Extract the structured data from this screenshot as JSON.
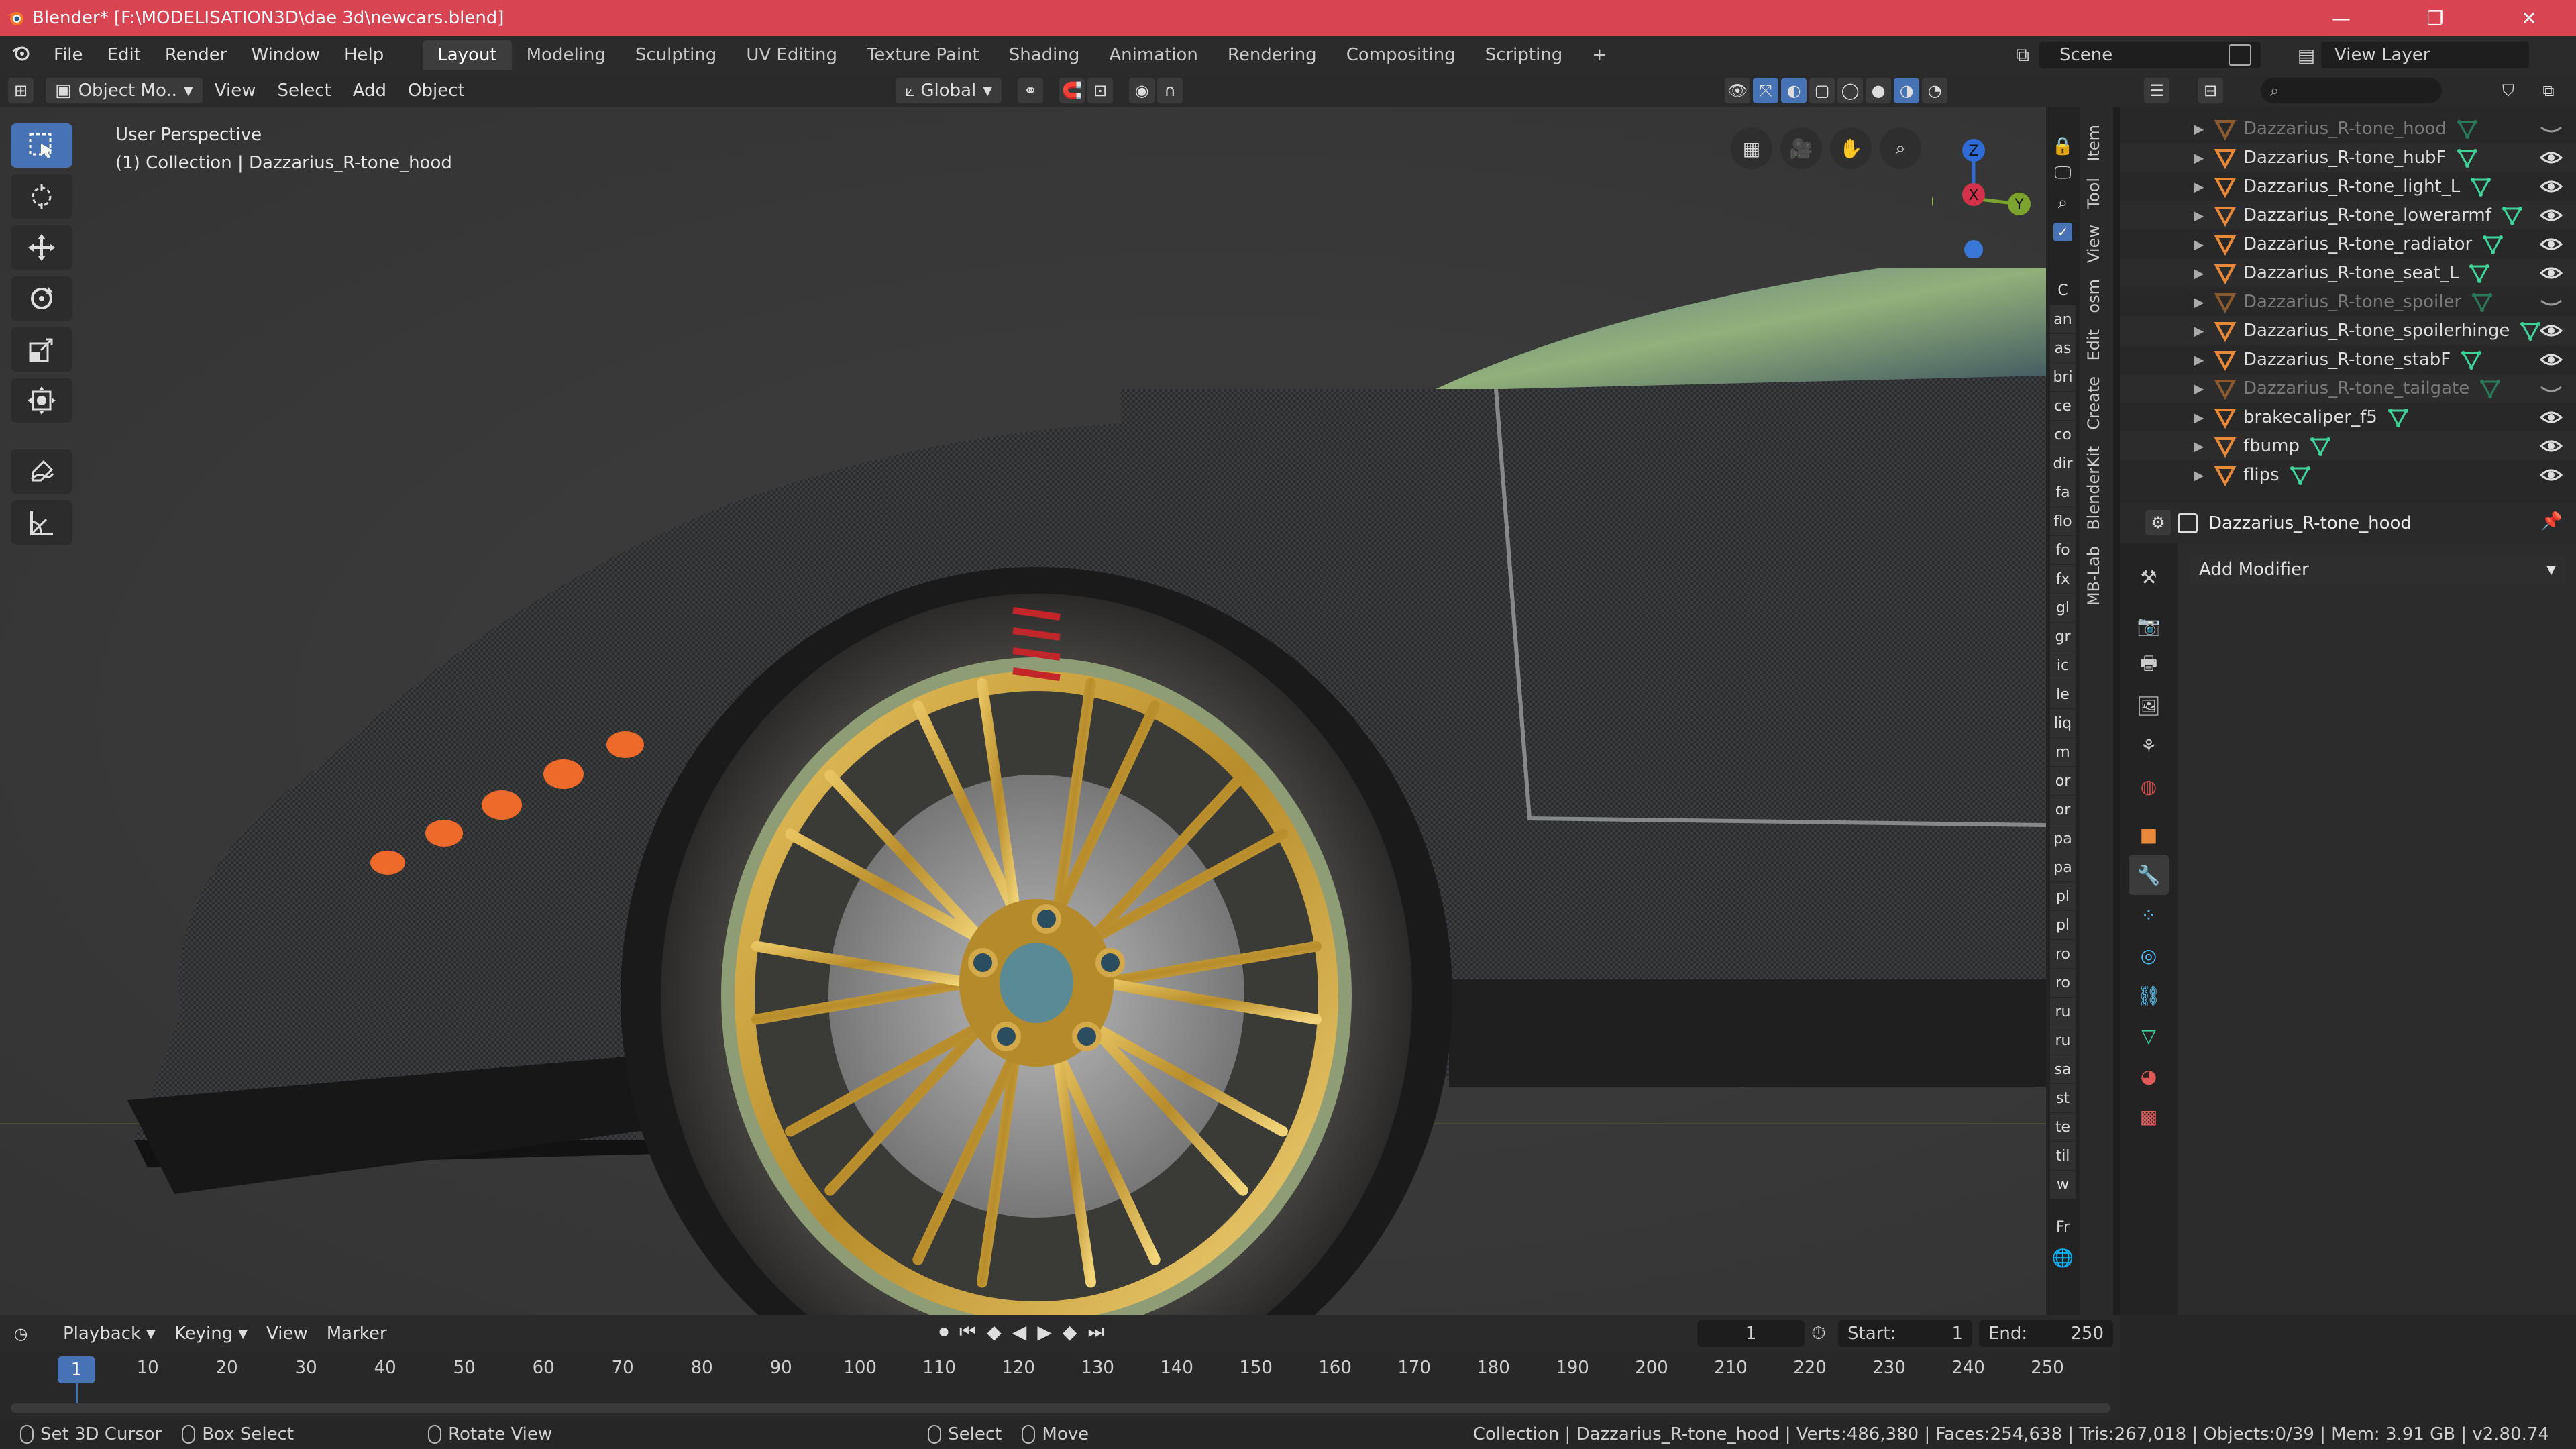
{
  "window": {
    "title": "Blender* [F:\\MODELISATION3D\\dae 3d\\newcars.blend]"
  },
  "menu": {
    "items": [
      "File",
      "Edit",
      "Render",
      "Window",
      "Help"
    ]
  },
  "workspaces": {
    "tabs": [
      "Layout",
      "Modeling",
      "Sculpting",
      "UV Editing",
      "Texture Paint",
      "Shading",
      "Animation",
      "Rendering",
      "Compositing",
      "Scripting"
    ],
    "active": "Layout",
    "add": "+"
  },
  "scene": {
    "name": "Scene"
  },
  "view_layer": {
    "name": "View Layer"
  },
  "viewport_header": {
    "mode": "Object Mo..",
    "view": "View",
    "select": "Select",
    "add": "Add",
    "object": "Object",
    "orientation": "Global"
  },
  "viewport": {
    "perspective": "User Perspective",
    "collection_info": "(1) Collection | Dazzarius_R-tone_hood",
    "gizmo": {
      "x": "X",
      "y": "Y",
      "z": "Z"
    }
  },
  "npanel_tabs": [
    "Item",
    "Tool",
    "View",
    "osm",
    "Edit",
    "Create",
    "BlenderKit",
    "MB-Lab"
  ],
  "addon_column": {
    "header": "C",
    "items": [
      "an",
      "as",
      "bri",
      "ce",
      "co",
      "dir",
      "fa",
      "flo",
      "fo",
      "fx",
      "gl",
      "gr",
      "ic",
      "le",
      "liq",
      "m",
      "or",
      "or",
      "pa",
      "pa",
      "pl",
      "pl",
      "ro",
      "ro",
      "ru",
      "ru",
      "sa",
      "st",
      "te",
      "til",
      "w"
    ],
    "footer": "Fr"
  },
  "outliner": {
    "rows": [
      {
        "name": "Dazzarius_R-tone_hood",
        "dim": true,
        "visible": false
      },
      {
        "name": "Dazzarius_R-tone_hubF",
        "dim": false,
        "visible": true
      },
      {
        "name": "Dazzarius_R-tone_light_L",
        "dim": false,
        "visible": true
      },
      {
        "name": "Dazzarius_R-tone_lowerarmf",
        "dim": false,
        "visible": true
      },
      {
        "name": "Dazzarius_R-tone_radiator",
        "dim": false,
        "visible": true
      },
      {
        "name": "Dazzarius_R-tone_seat_L",
        "dim": false,
        "visible": true
      },
      {
        "name": "Dazzarius_R-tone_spoiler",
        "dim": true,
        "visible": false
      },
      {
        "name": "Dazzarius_R-tone_spoilerhinge",
        "dim": false,
        "visible": true
      },
      {
        "name": "Dazzarius_R-tone_stabF",
        "dim": false,
        "visible": true
      },
      {
        "name": "Dazzarius_R-tone_tailgate",
        "dim": true,
        "visible": false
      },
      {
        "name": "brakecaliper_f5",
        "dim": false,
        "visible": true
      },
      {
        "name": "fbump",
        "dim": false,
        "visible": true
      },
      {
        "name": "flips",
        "dim": false,
        "visible": true
      }
    ]
  },
  "properties": {
    "object_name": "Dazzarius_R-tone_hood",
    "add_modifier": "Add Modifier"
  },
  "timeline": {
    "menus": [
      "Playback",
      "Keying",
      "View",
      "Marker"
    ],
    "current_frame": "1",
    "start_label": "Start:",
    "start": "1",
    "end_label": "End:",
    "end": "250",
    "ticks": [
      "1",
      "10",
      "20",
      "30",
      "40",
      "50",
      "60",
      "70",
      "80",
      "90",
      "100",
      "110",
      "120",
      "130",
      "140",
      "150",
      "160",
      "170",
      "180",
      "190",
      "200",
      "210",
      "220",
      "230",
      "240",
      "250"
    ]
  },
  "statusbar": {
    "left_click": "Set 3D Cursor",
    "box_select": "Box Select",
    "rotate_view": "Rotate View",
    "select": "Select",
    "move": "Move",
    "stats": "Collection | Dazzarius_R-tone_hood | Verts:486,380 | Faces:254,638 | Tris:267,018 | Objects:0/39 | Mem: 3.91 GB | v2.80.74"
  },
  "colors": {
    "title_bar": "#d84452",
    "accent": "#4772b3",
    "object_orange": "#e8893a",
    "mesh_green": "#3fd39a"
  }
}
